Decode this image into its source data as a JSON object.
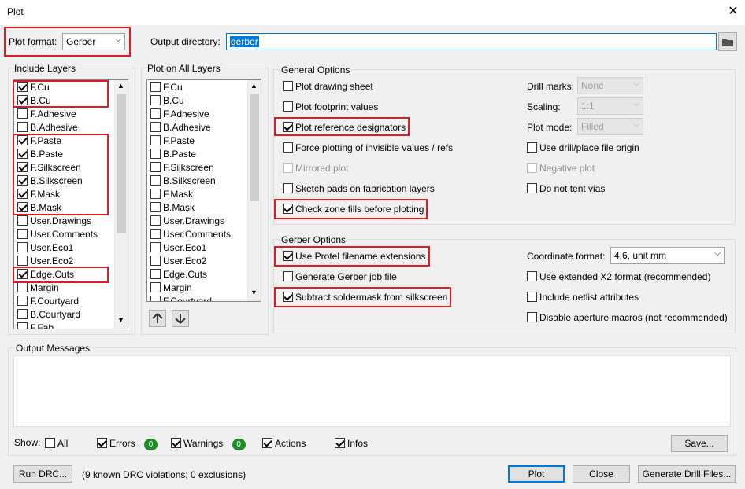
{
  "window": {
    "title": "Plot"
  },
  "plot_format": {
    "label": "Plot format:",
    "value": "Gerber"
  },
  "output_dir": {
    "label": "Output directory:",
    "value": "gerber"
  },
  "include_layers": {
    "title": "Include Layers",
    "items": [
      {
        "label": "F.Cu",
        "checked": true
      },
      {
        "label": "B.Cu",
        "checked": true
      },
      {
        "label": "F.Adhesive",
        "checked": false
      },
      {
        "label": "B.Adhesive",
        "checked": false
      },
      {
        "label": "F.Paste",
        "checked": true
      },
      {
        "label": "B.Paste",
        "checked": true
      },
      {
        "label": "F.Silkscreen",
        "checked": true
      },
      {
        "label": "B.Silkscreen",
        "checked": true
      },
      {
        "label": "F.Mask",
        "checked": true
      },
      {
        "label": "B.Mask",
        "checked": true
      },
      {
        "label": "User.Drawings",
        "checked": false
      },
      {
        "label": "User.Comments",
        "checked": false
      },
      {
        "label": "User.Eco1",
        "checked": false
      },
      {
        "label": "User.Eco2",
        "checked": false
      },
      {
        "label": "Edge.Cuts",
        "checked": true
      },
      {
        "label": "Margin",
        "checked": false
      },
      {
        "label": "F.Courtyard",
        "checked": false
      },
      {
        "label": "B.Courtyard",
        "checked": false
      },
      {
        "label": "F.Fab",
        "checked": false
      }
    ]
  },
  "plot_all_layers": {
    "title": "Plot on All Layers",
    "items": [
      {
        "label": "F.Cu",
        "checked": false
      },
      {
        "label": "B.Cu",
        "checked": false
      },
      {
        "label": "F.Adhesive",
        "checked": false
      },
      {
        "label": "B.Adhesive",
        "checked": false
      },
      {
        "label": "F.Paste",
        "checked": false
      },
      {
        "label": "B.Paste",
        "checked": false
      },
      {
        "label": "F.Silkscreen",
        "checked": false
      },
      {
        "label": "B.Silkscreen",
        "checked": false
      },
      {
        "label": "F.Mask",
        "checked": false
      },
      {
        "label": "B.Mask",
        "checked": false
      },
      {
        "label": "User.Drawings",
        "checked": false
      },
      {
        "label": "User.Comments",
        "checked": false
      },
      {
        "label": "User.Eco1",
        "checked": false
      },
      {
        "label": "User.Eco2",
        "checked": false
      },
      {
        "label": "Edge.Cuts",
        "checked": false
      },
      {
        "label": "Margin",
        "checked": false
      },
      {
        "label": "F.Courtyard",
        "checked": false
      }
    ],
    "move_up_icon": "arrow-up",
    "move_down_icon": "arrow-down"
  },
  "general_options": {
    "title": "General Options",
    "left": [
      {
        "label": "Plot drawing sheet",
        "checked": false,
        "disabled": false
      },
      {
        "label": "Plot footprint values",
        "checked": false,
        "disabled": false
      },
      {
        "label": "Plot reference designators",
        "checked": true,
        "disabled": false
      },
      {
        "label": "Force plotting of invisible values / refs",
        "checked": false,
        "disabled": false
      },
      {
        "label": "Mirrored plot",
        "checked": false,
        "disabled": true
      },
      {
        "label": "Sketch pads on fabrication layers",
        "checked": false,
        "disabled": false
      },
      {
        "label": "Check zone fills before plotting",
        "checked": true,
        "disabled": false
      }
    ],
    "drill_marks": {
      "label": "Drill marks:",
      "value": "None"
    },
    "scaling": {
      "label": "Scaling:",
      "value": "1:1"
    },
    "plot_mode": {
      "label": "Plot mode:",
      "value": "Filled"
    },
    "right": [
      {
        "label": "Use drill/place file origin",
        "checked": false,
        "disabled": false
      },
      {
        "label": "Negative plot",
        "checked": false,
        "disabled": true
      },
      {
        "label": "Do not tent vias",
        "checked": false,
        "disabled": false
      }
    ]
  },
  "gerber_options": {
    "title": "Gerber Options",
    "left": [
      {
        "label": "Use Protel filename extensions",
        "checked": true
      },
      {
        "label": "Generate Gerber job file",
        "checked": false
      },
      {
        "label": "Subtract soldermask from silkscreen",
        "checked": true
      }
    ],
    "coordinate_format": {
      "label": "Coordinate format:",
      "value": "4.6, unit mm"
    },
    "right": [
      {
        "label": "Use extended X2 format (recommended)",
        "checked": false
      },
      {
        "label": "Include netlist attributes",
        "checked": false
      },
      {
        "label": "Disable aperture macros (not recommended)",
        "checked": false
      }
    ]
  },
  "messages": {
    "title": "Output Messages",
    "show_label": "Show:",
    "filters": {
      "all": {
        "label": "All",
        "checked": false
      },
      "errors": {
        "label": "Errors",
        "checked": true,
        "count": "0"
      },
      "warnings": {
        "label": "Warnings",
        "checked": true,
        "count": "0"
      },
      "actions": {
        "label": "Actions",
        "checked": true
      },
      "infos": {
        "label": "Infos",
        "checked": true
      }
    },
    "save_button": "Save..."
  },
  "footer": {
    "run_drc": "Run DRC...",
    "drc_status": "(9 known DRC violations; 0 exclusions)",
    "plot": "Plot",
    "close": "Close",
    "generate_drill": "Generate Drill Files..."
  },
  "colors": {
    "highlight": "#e01b24",
    "accent": "#0078d7",
    "badge": "#1e8c28"
  }
}
